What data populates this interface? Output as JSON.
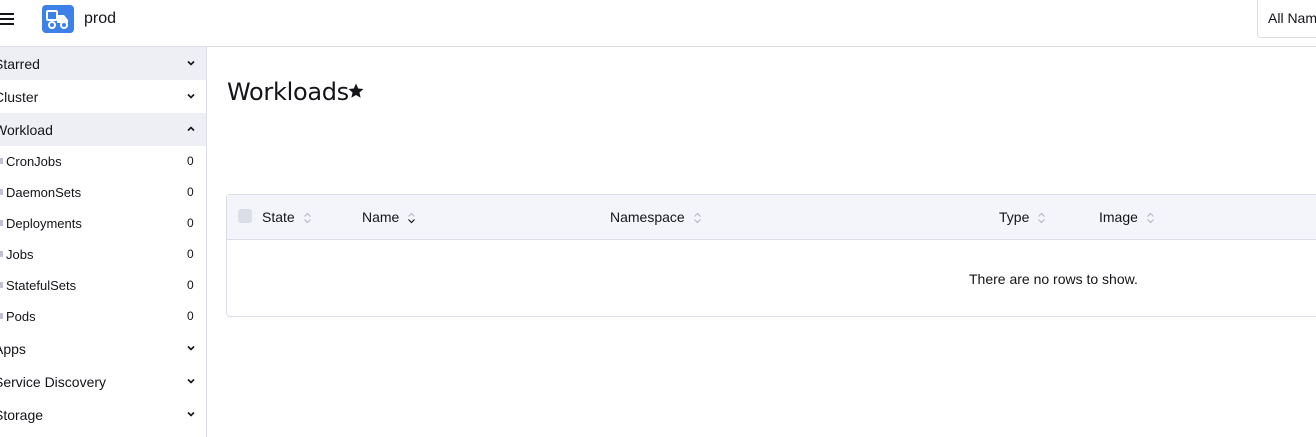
{
  "header": {
    "cluster_name": "prod",
    "namespace_filter": "All Namespaces"
  },
  "sidebar": {
    "groups": [
      {
        "label": "Starred",
        "expanded": false
      },
      {
        "label": "Cluster",
        "expanded": false
      },
      {
        "label": "Workload",
        "expanded": true
      },
      {
        "label": "Apps",
        "expanded": false
      },
      {
        "label": "Service Discovery",
        "expanded": false
      },
      {
        "label": "Storage",
        "expanded": false
      }
    ],
    "workload_items": [
      {
        "label": "CronJobs",
        "count": "0"
      },
      {
        "label": "DaemonSets",
        "count": "0"
      },
      {
        "label": "Deployments",
        "count": "0"
      },
      {
        "label": "Jobs",
        "count": "0"
      },
      {
        "label": "StatefulSets",
        "count": "0"
      },
      {
        "label": "Pods",
        "count": "0"
      }
    ]
  },
  "main": {
    "title": "Workloads",
    "table": {
      "columns": [
        "State",
        "Name",
        "Namespace",
        "Type",
        "Image"
      ],
      "empty_message": "There are no rows to show."
    }
  },
  "colors": {
    "accent": "#3d80e8",
    "sidebar_selected_bg": "#eeeff4",
    "table_header_bg": "#f4f5fa",
    "border": "#dcdee7"
  },
  "icons": {
    "menu": "hamburger-icon",
    "logo": "cluster-logo-icon",
    "star": "star-icon",
    "chevron_down": "chevron-down-icon",
    "chevron_up": "chevron-up-icon",
    "sort": "sort-icon"
  }
}
